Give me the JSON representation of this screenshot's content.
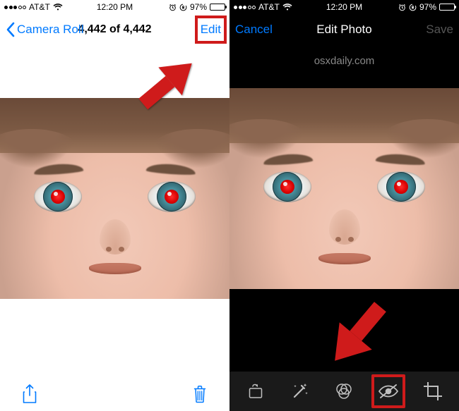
{
  "left": {
    "status": {
      "carrier": "AT&T",
      "time": "12:20 PM",
      "battery_pct": "97%"
    },
    "nav": {
      "back_label": "Camera Roll",
      "title": "4,442 of 4,442",
      "edit_label": "Edit"
    },
    "toolbar": {
      "share_label": "Share",
      "trash_label": "Delete"
    }
  },
  "right": {
    "status": {
      "carrier": "AT&T",
      "time": "12:20 PM",
      "battery_pct": "97%"
    },
    "nav": {
      "cancel_label": "Cancel",
      "title": "Edit Photo",
      "save_label": "Save"
    },
    "watermark": "osxdaily.com",
    "toolbar": {
      "rotate_label": "Rotate",
      "enhance_label": "Auto-Enhance",
      "filters_label": "Filters",
      "redeye_label": "Red-Eye",
      "crop_label": "Crop"
    }
  }
}
